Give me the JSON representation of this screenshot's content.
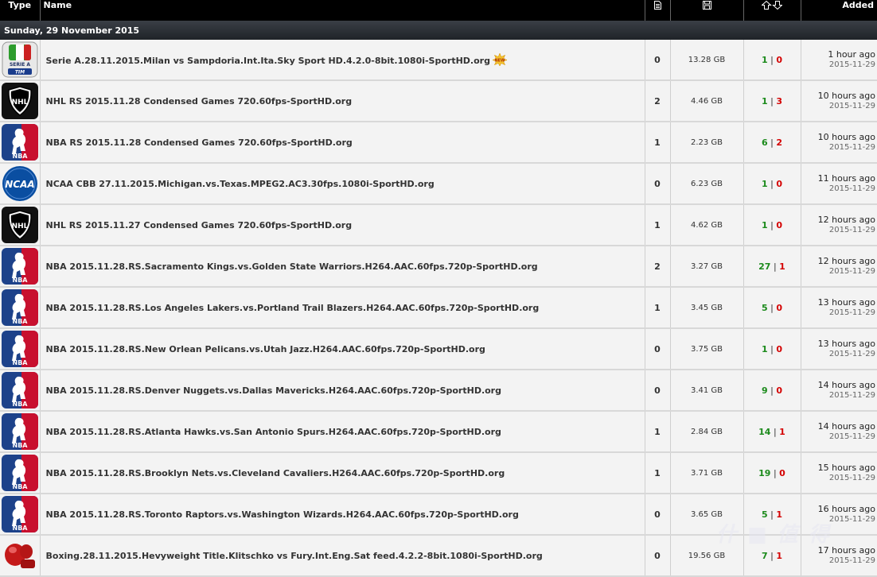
{
  "header": {
    "type": "Type",
    "name": "Name",
    "files_icon": "file-icon",
    "size_icon": "disk-icon",
    "peers_icon": "arrows-up-down-icon",
    "added": "Added"
  },
  "day_label": "Sunday, 29 November 2015",
  "new_badge_icon": "new-star-icon",
  "rows": [
    {
      "logo": "serie-a",
      "name": "Serie A.28.11.2015.Milan vs Sampdoria.Int.Ita.Sky Sport HD.4.2.0-8bit.1080i-SportHD.org",
      "new": true,
      "files": "0",
      "size": "13.28 GB",
      "seeders": "1",
      "leechers": "0",
      "ago": "1 hour ago",
      "date": "2015-11-29"
    },
    {
      "logo": "nhl",
      "name": "NHL RS 2015.11.28 Condensed Games 720.60fps-SportHD.org",
      "files": "2",
      "size": "4.46 GB",
      "seeders": "1",
      "leechers": "3",
      "ago": "10 hours ago",
      "date": "2015-11-29"
    },
    {
      "logo": "nba",
      "name": "NBA RS 2015.11.28 Condensed Games 720.60fps-SportHD.org",
      "files": "1",
      "size": "2.23 GB",
      "seeders": "6",
      "leechers": "2",
      "ago": "10 hours ago",
      "date": "2015-11-29"
    },
    {
      "logo": "ncaa",
      "name": "NCAA CBB 27.11.2015.Michigan.vs.Texas.MPEG2.AC3.30fps.1080i-SportHD.org",
      "files": "0",
      "size": "6.23 GB",
      "seeders": "1",
      "leechers": "0",
      "ago": "11 hours ago",
      "date": "2015-11-29"
    },
    {
      "logo": "nhl",
      "name": "NHL RS 2015.11.27 Condensed Games 720.60fps-SportHD.org",
      "files": "1",
      "size": "4.62 GB",
      "seeders": "1",
      "leechers": "0",
      "ago": "12 hours ago",
      "date": "2015-11-29"
    },
    {
      "logo": "nba",
      "name": "NBA 2015.11.28.RS.Sacramento Kings.vs.Golden State Warriors.H264.AAC.60fps.720p-SportHD.org",
      "files": "2",
      "size": "3.27 GB",
      "seeders": "27",
      "leechers": "1",
      "ago": "12 hours ago",
      "date": "2015-11-29"
    },
    {
      "logo": "nba",
      "name": "NBA 2015.11.28.RS.Los Angeles Lakers.vs.Portland Trail Blazers.H264.AAC.60fps.720p-SportHD.org",
      "files": "1",
      "size": "3.45 GB",
      "seeders": "5",
      "leechers": "0",
      "ago": "13 hours ago",
      "date": "2015-11-29"
    },
    {
      "logo": "nba",
      "name": "NBA 2015.11.28.RS.New Orlean Pelicans.vs.Utah Jazz.H264.AAC.60fps.720p-SportHD.org",
      "files": "0",
      "size": "3.75 GB",
      "seeders": "1",
      "leechers": "0",
      "ago": "13 hours ago",
      "date": "2015-11-29"
    },
    {
      "logo": "nba",
      "name": "NBA 2015.11.28.RS.Denver Nuggets.vs.Dallas Mavericks.H264.AAC.60fps.720p-SportHD.org",
      "files": "0",
      "size": "3.41 GB",
      "seeders": "9",
      "leechers": "0",
      "ago": "14 hours ago",
      "date": "2015-11-29"
    },
    {
      "logo": "nba",
      "name": "NBA 2015.11.28.RS.Atlanta Hawks.vs.San Antonio Spurs.H264.AAC.60fps.720p-SportHD.org",
      "files": "1",
      "size": "2.84 GB",
      "seeders": "14",
      "leechers": "1",
      "ago": "14 hours ago",
      "date": "2015-11-29"
    },
    {
      "logo": "nba",
      "name": "NBA 2015.11.28.RS.Brooklyn Nets.vs.Cleveland Cavaliers.H264.AAC.60fps.720p-SportHD.org",
      "files": "1",
      "size": "3.71 GB",
      "seeders": "19",
      "leechers": "0",
      "ago": "15 hours ago",
      "date": "2015-11-29"
    },
    {
      "logo": "nba",
      "name": "NBA 2015.11.28.RS.Toronto Raptors.vs.Washington Wizards.H264.AAC.60fps.720p-SportHD.org",
      "files": "0",
      "size": "3.65 GB",
      "seeders": "5",
      "leechers": "1",
      "ago": "16 hours ago",
      "date": "2015-11-29"
    },
    {
      "logo": "boxing",
      "name": "Boxing.28.11.2015.Hevyweight Title.Klitschko vs Fury.Int.Eng.Sat feed.4.2.2-8bit.1080i-SportHD.org",
      "files": "0",
      "size": "19.56 GB",
      "seeders": "7",
      "leechers": "1",
      "ago": "17 hours ago",
      "date": "2015-11-29"
    }
  ],
  "colors": {
    "seeders": "#1b8a1b",
    "leechers": "#d40000",
    "header_bg": "#000000",
    "row_bg": "#f3f3f3"
  }
}
